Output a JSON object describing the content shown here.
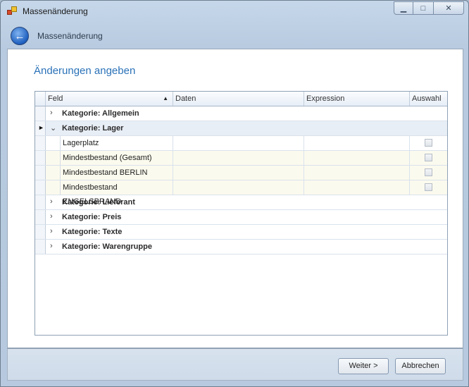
{
  "window": {
    "title": "Massenänderung",
    "controls": {
      "minimize": "▁",
      "maximize": "□",
      "close": "✕"
    }
  },
  "nav": {
    "back_icon": "←",
    "title": "Massenänderung"
  },
  "page": {
    "heading": "Änderungen angeben"
  },
  "grid": {
    "columns": [
      "Feld",
      "Daten",
      "Expression",
      "Auswahl"
    ],
    "sort_icon": "▲",
    "categories": [
      {
        "label": "Kategorie: Allgemein",
        "expander": "›"
      },
      {
        "label": "Kategorie: Lager",
        "expander": "⌄",
        "pointer": "►"
      },
      {
        "label": "Kategorie: Lieferant",
        "expander": "›"
      },
      {
        "label": "Kategorie: Preis",
        "expander": "›"
      },
      {
        "label": "Kategorie: Texte",
        "expander": "›"
      },
      {
        "label": "Kategorie: Warengruppe",
        "expander": "›"
      }
    ],
    "lager_fields": [
      {
        "feld": "Lagerplatz",
        "daten": "",
        "expression": "",
        "auswahl": false
      },
      {
        "feld": "Mindestbestand (Gesamt)",
        "daten": "",
        "expression": "",
        "auswahl": false
      },
      {
        "feld": "Mindestbestand BERLIN",
        "daten": "",
        "expression": "",
        "auswahl": false
      },
      {
        "feld": "Mindestbestand ENGELSBRAND",
        "daten": "",
        "expression": "",
        "auswahl": false
      }
    ]
  },
  "footer": {
    "next_label": "Weiter >",
    "cancel_label": "Abbrechen"
  }
}
